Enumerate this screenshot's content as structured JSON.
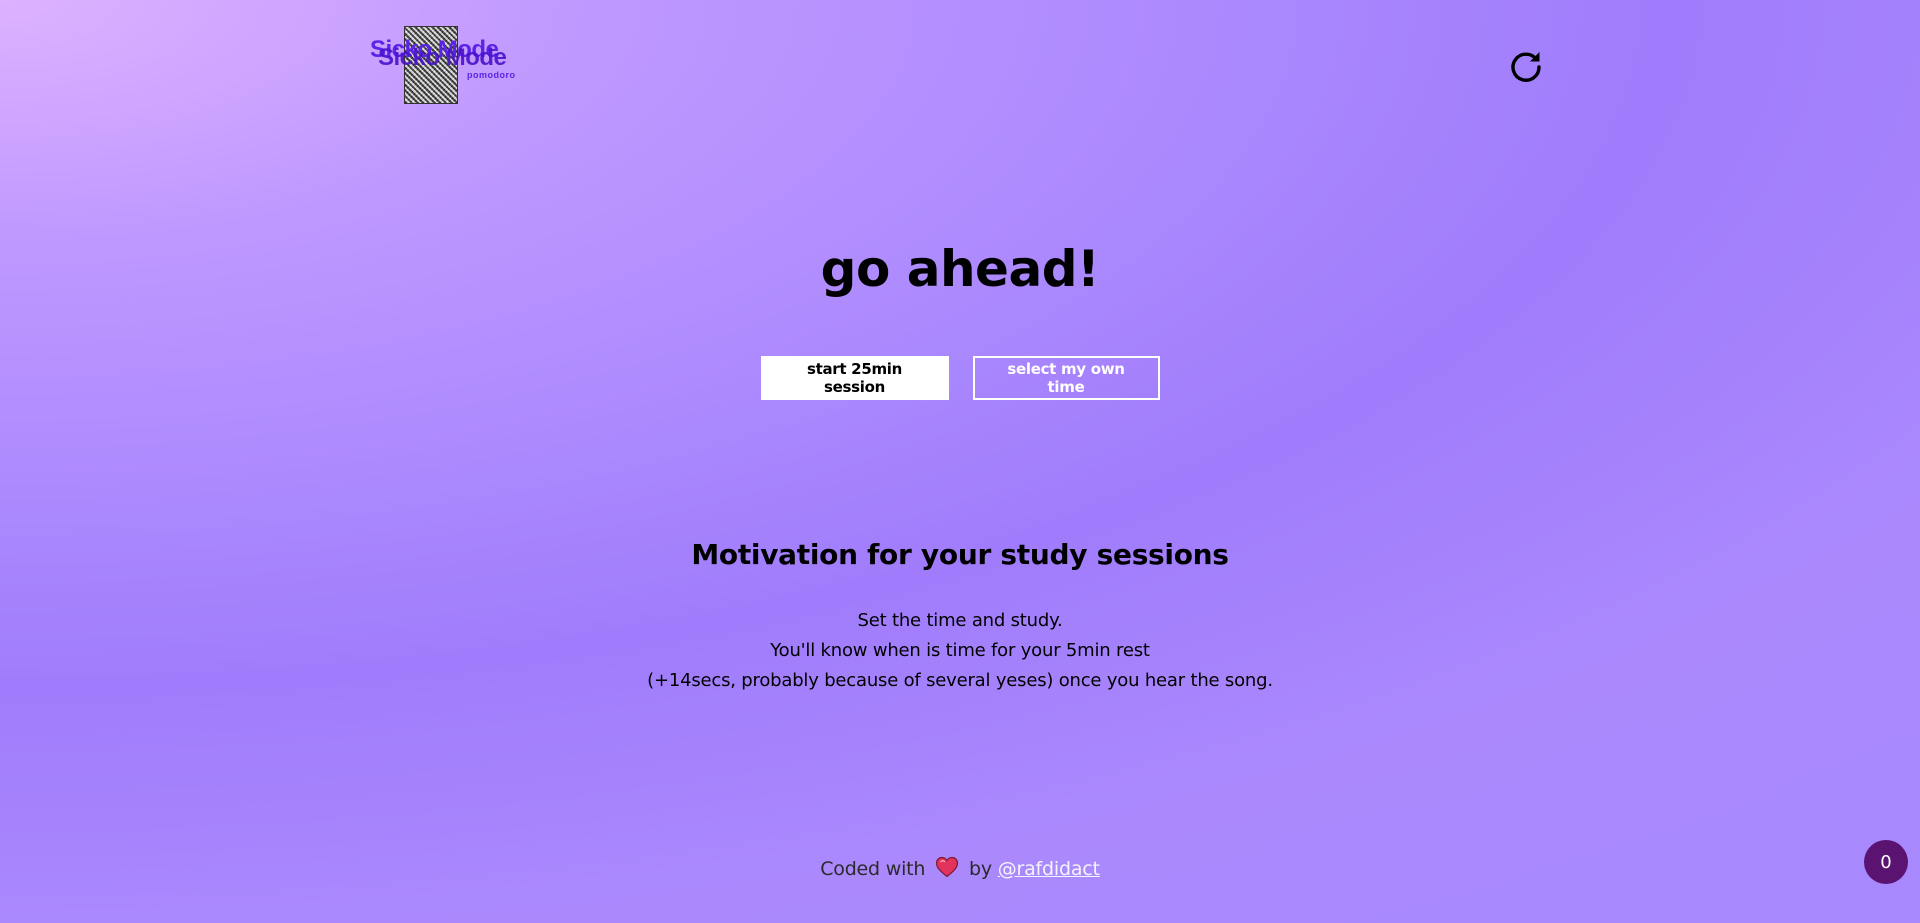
{
  "header": {
    "logo": {
      "title": "Sicko Mode",
      "subtitle": "pomodoro",
      "icon": "sicko-mode-logo"
    },
    "refresh": {
      "icon": "refresh-icon"
    }
  },
  "hero": {
    "title": "go ahead!",
    "primary_button": "start 25min session",
    "secondary_button": "select my own time"
  },
  "motivation": {
    "title": "Motivation for your study sessions",
    "lines": [
      "Set the time and study.",
      "You'll know when is time for your 5min rest",
      "(+14secs, probably because of several yeses) once you hear the song."
    ]
  },
  "footer": {
    "prefix": "Coded with",
    "heart_icon": "heart-icon",
    "by": "by",
    "author_link": "@rafdidact"
  },
  "counter": {
    "value": "0"
  },
  "colors": {
    "background_start": "#dcb2ff",
    "background_mid": "#a07cfc",
    "logo_purple": "#5b22e8",
    "badge": "#5a1371",
    "heart": "#e2335c"
  }
}
